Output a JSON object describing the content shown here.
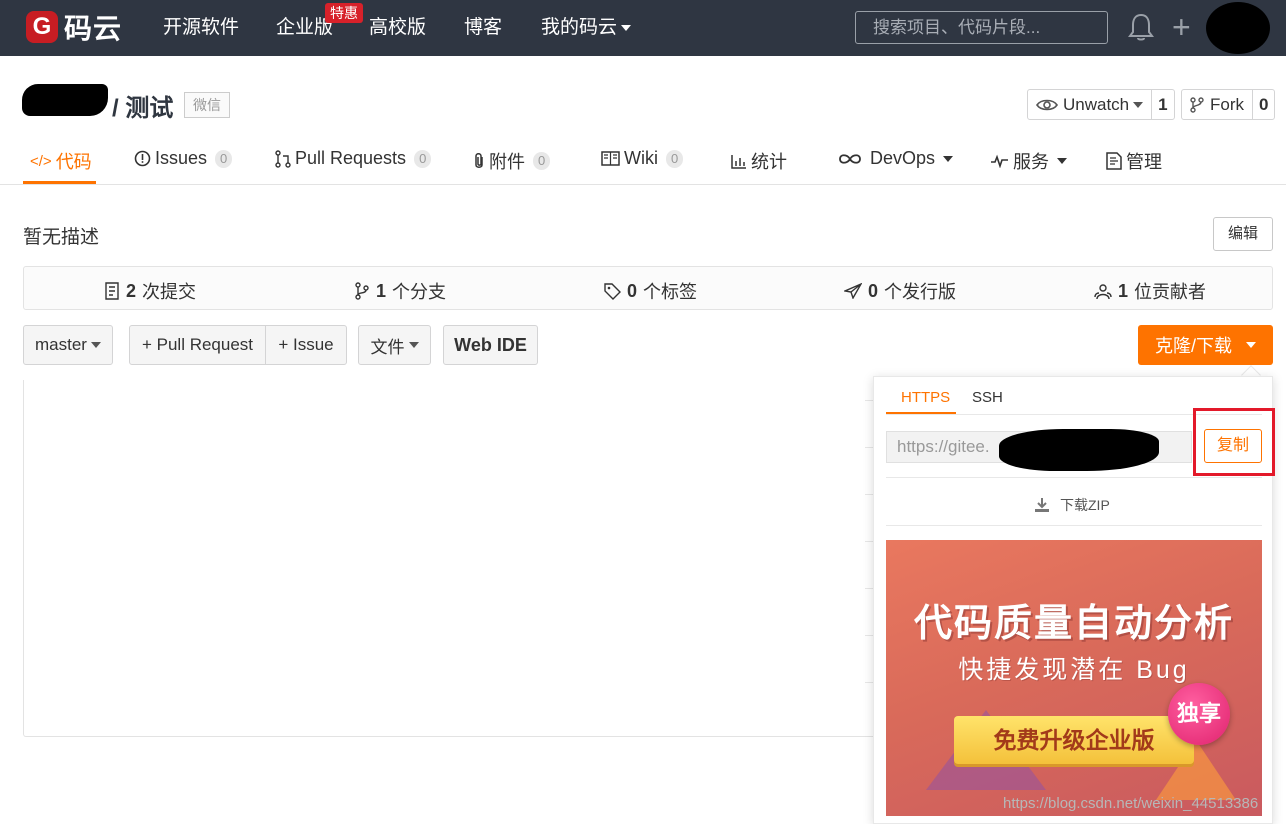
{
  "topbar": {
    "logo_mark": "G",
    "logo_text": "码云",
    "nav": [
      "开源软件",
      "企业版",
      "高校版",
      "博客",
      "我的码云"
    ],
    "badge": "特惠",
    "search_placeholder": "搜索项目、代码片段..."
  },
  "repo": {
    "title": "/ 测试",
    "tag": "微信",
    "watch_label": "Unwatch",
    "watch_count": "1",
    "fork_label": "Fork",
    "fork_count": "0"
  },
  "tabs": [
    {
      "label": "代码"
    },
    {
      "label": "Issues",
      "count": "0"
    },
    {
      "label": "Pull Requests",
      "count": "0"
    },
    {
      "label": "附件",
      "count": "0"
    },
    {
      "label": "Wiki",
      "count": "0"
    },
    {
      "label": "统计"
    },
    {
      "label": "DevOps"
    },
    {
      "label": "服务"
    },
    {
      "label": "管理"
    }
  ],
  "description": "暂无描述",
  "edit_label": "编辑",
  "stats": [
    {
      "num": "2",
      "label": "次提交"
    },
    {
      "num": "1",
      "label": "个分支"
    },
    {
      "num": "0",
      "label": "个标签"
    },
    {
      "num": "0",
      "label": "个发行版"
    },
    {
      "num": "1",
      "label": "位贡献者"
    }
  ],
  "controls": {
    "branch": "master",
    "pull_request": "+ Pull Request",
    "issue": "+ Issue",
    "file": "文件",
    "webide": "Web IDE",
    "clone": "克隆/下载"
  },
  "dropdown": {
    "tabs": [
      "HTTPS",
      "SSH"
    ],
    "url": "https://gitee.",
    "copy": "复制",
    "zip": "下载ZIP"
  },
  "banner": {
    "title": "代码质量自动分析",
    "subtitle": "快捷发现潜在 Bug",
    "button": "免费升级企业版",
    "badge": "独享"
  },
  "watermark": "https://blog.csdn.net/weixin_44513386",
  "colors": {
    "accent": "#fe7300",
    "topbar": "#2f3642",
    "highlight": "#e3192a"
  }
}
